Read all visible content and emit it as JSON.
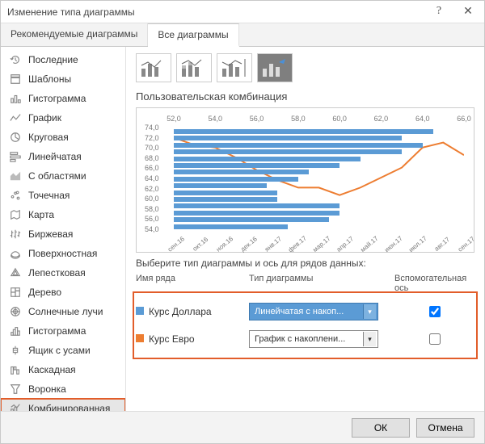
{
  "window": {
    "title": "Изменение типа диаграммы"
  },
  "tabs": {
    "recommended": "Рекомендуемые диаграммы",
    "all": "Все диаграммы"
  },
  "sidebar": {
    "items": [
      {
        "label": "Последние",
        "icon": "recent"
      },
      {
        "label": "Шаблоны",
        "icon": "template"
      },
      {
        "label": "Гистограмма",
        "icon": "bar"
      },
      {
        "label": "График",
        "icon": "line"
      },
      {
        "label": "Круговая",
        "icon": "pie"
      },
      {
        "label": "Линейчатая",
        "icon": "hbar"
      },
      {
        "label": "С областями",
        "icon": "area"
      },
      {
        "label": "Точечная",
        "icon": "scatter"
      },
      {
        "label": "Карта",
        "icon": "map"
      },
      {
        "label": "Биржевая",
        "icon": "stock"
      },
      {
        "label": "Поверхностная",
        "icon": "surface"
      },
      {
        "label": "Лепестковая",
        "icon": "radar"
      },
      {
        "label": "Дерево",
        "icon": "tree"
      },
      {
        "label": "Солнечные лучи",
        "icon": "sunburst"
      },
      {
        "label": "Гистограмма",
        "icon": "histogram"
      },
      {
        "label": "Ящик с усами",
        "icon": "boxplot"
      },
      {
        "label": "Каскадная",
        "icon": "waterfall"
      },
      {
        "label": "Воронка",
        "icon": "funnel"
      },
      {
        "label": "Комбинированная",
        "icon": "combo"
      }
    ]
  },
  "subtype_section": {
    "title": "Пользовательская комбинация"
  },
  "series_section": {
    "prompt": "Выберите тип диаграммы и ось для рядов данных:",
    "headers": {
      "name": "Имя ряда",
      "type": "Тип диаграммы",
      "axis": "Вспомогательная ось"
    },
    "rows": [
      {
        "swatch": "#5b9bd5",
        "name": "Курс Доллара",
        "type": "Линейчатая с накоп...",
        "secondary": true
      },
      {
        "swatch": "#ed7d31",
        "name": "Курс Евро",
        "type": "График с накоплени...",
        "secondary": false
      }
    ]
  },
  "footer": {
    "ok": "ОК",
    "cancel": "Отмена"
  },
  "chart_data": {
    "type": "combo",
    "categories": [
      "сен.16",
      "окт.16",
      "ноя.16",
      "дек.16",
      "янв.17",
      "фев.17",
      "мар.17",
      "апр.17",
      "май.17",
      "июн.17",
      "июл.17",
      "авг.17",
      "сен.17"
    ],
    "y_primary": {
      "min": 54,
      "max": 74,
      "step": 2
    },
    "x_secondary_top": {
      "min": 52,
      "max": 66,
      "step": 2
    },
    "series": [
      {
        "name": "Курс Доллара",
        "type": "hbar_secondary_x",
        "color": "#5b9bd5",
        "values": [
          64.5,
          63.0,
          64.0,
          63.0,
          61.0,
          60.0,
          58.5,
          58.0,
          56.5,
          57.0,
          57.0,
          60.0,
          60.0,
          59.5,
          57.5
        ]
      },
      {
        "name": "Курс Евро",
        "type": "line_primary_y",
        "color": "#ed7d31",
        "values": [
          72.0,
          70.5,
          70.0,
          68.0,
          65.5,
          63.5,
          62.0,
          62.0,
          60.5,
          62.0,
          64.0,
          66.0,
          70.0,
          71.0,
          68.5
        ]
      }
    ]
  }
}
